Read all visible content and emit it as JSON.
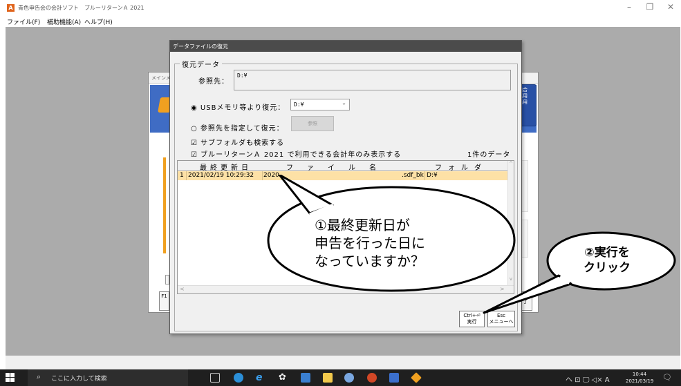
{
  "window": {
    "title": "青色申告会の会計ソフト　ブルーリターンＡ 2021",
    "minimize": "–",
    "maximize": "❐",
    "close": "✕"
  },
  "menu": [
    {
      "label": "ファイル(F)"
    },
    {
      "label": "補助機能(A)"
    },
    {
      "label": "ヘルプ(H)"
    }
  ],
  "background_window": {
    "header": "メインメ",
    "side_button": "総合\n活用\n活用",
    "f1": "F1",
    "right_btn": "了"
  },
  "dialog": {
    "title": "データファイルの復元",
    "group_label": "復元データ",
    "ref_label": "参照先：",
    "ref_value": "D:¥",
    "radio_usb": "◉ USBメモリ等より復元：",
    "usb_value": "D:¥",
    "radio_ref": "○ 参照先を指定して復元：",
    "browse_button": "参照",
    "check_subfolder": "☑ サブフォルダも検索する",
    "check_year": "☑ ブルーリターンＡ 2021 で利用できる会計年のみ表示する",
    "count_text": "1件のデータ",
    "grid": {
      "headers": [
        "最終更新日",
        "ファイル名",
        "フォルダ"
      ],
      "rows": [
        {
          "no": "1",
          "date": "2021/02/19 10:29:32",
          "name": "2020",
          "ext": ".sdf_bk",
          "folder": "D:¥"
        }
      ]
    },
    "exec_button": {
      "top": "Ctrl+⏎",
      "bottom": "実行"
    },
    "esc_button": {
      "top": "Esc",
      "bottom": "メニューへ"
    }
  },
  "callouts": {
    "first": {
      "line1": "①最終更新日が",
      "line2": "申告を行った日に",
      "line3": "なっていますか？"
    },
    "second": {
      "line1": "②実行を",
      "line2": "クリック"
    }
  },
  "taskbar": {
    "search_placeholder": "ここに入力して検索",
    "tray_text": "へ ⊡ 🖵 ◁× A",
    "time": "10:44",
    "date": "2021/03/19",
    "notify": "🗨"
  },
  "colors": {
    "dialog_title_bg": "#4b4b4b",
    "selected_row": "#fde1a6",
    "banner_blue": "#3f6cc4",
    "accent_orange": "#e0641c"
  }
}
